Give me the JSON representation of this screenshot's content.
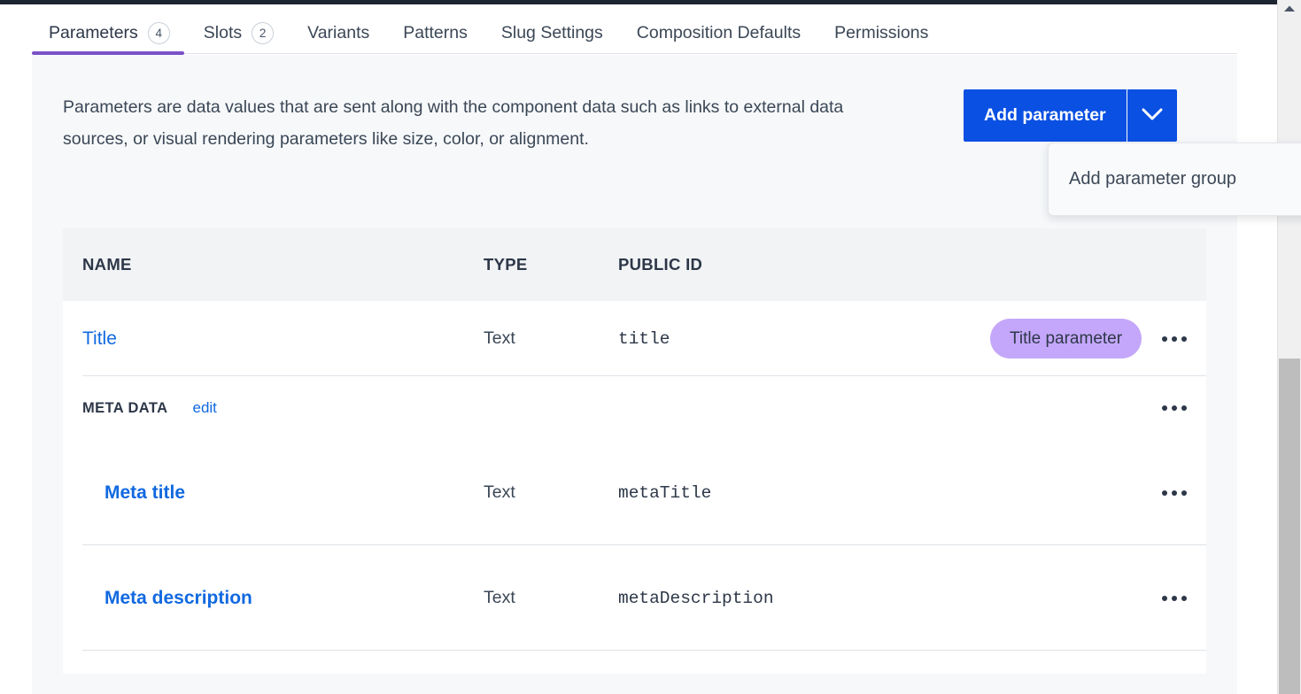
{
  "tabs": [
    {
      "label": "Parameters",
      "count": "4",
      "active": true
    },
    {
      "label": "Slots",
      "count": "2",
      "active": false
    },
    {
      "label": "Variants",
      "count": "",
      "active": false
    },
    {
      "label": "Patterns",
      "count": "",
      "active": false
    },
    {
      "label": "Slug Settings",
      "count": "",
      "active": false
    },
    {
      "label": "Composition Defaults",
      "count": "",
      "active": false
    },
    {
      "label": "Permissions",
      "count": "",
      "active": false
    }
  ],
  "description": "Parameters are data values that are sent along with the component data such as links to external data sources, or visual rendering parameters like size, color, or alignment.",
  "toolbar": {
    "add_parameter_label": "Add parameter",
    "caret_icon": "chevron-down-icon",
    "accent_color": "#0a50e3"
  },
  "dropdown": {
    "open": true,
    "items": [
      {
        "label": "Add parameter group"
      }
    ]
  },
  "table": {
    "headers": {
      "name": "NAME",
      "type": "TYPE",
      "public_id": "PUBLIC ID"
    },
    "rows": [
      {
        "kind": "parameter",
        "name": "Title",
        "type": "Text",
        "public_id": "title",
        "badge": "Title parameter",
        "badge_color": "#c4a7fa",
        "menu_icon": "ellipsis-icon"
      },
      {
        "kind": "group",
        "name": "META DATA",
        "edit_label": "edit",
        "menu_icon": "ellipsis-icon",
        "children": [
          {
            "name": "Meta title",
            "type": "Text",
            "public_id": "metaTitle",
            "menu_icon": "ellipsis-icon"
          },
          {
            "name": "Meta description",
            "type": "Text",
            "public_id": "metaDescription",
            "menu_icon": "ellipsis-icon"
          }
        ]
      }
    ]
  },
  "scrollbar": {
    "up_arrow_icon": "caret-up-icon",
    "orientation": "vertical"
  }
}
